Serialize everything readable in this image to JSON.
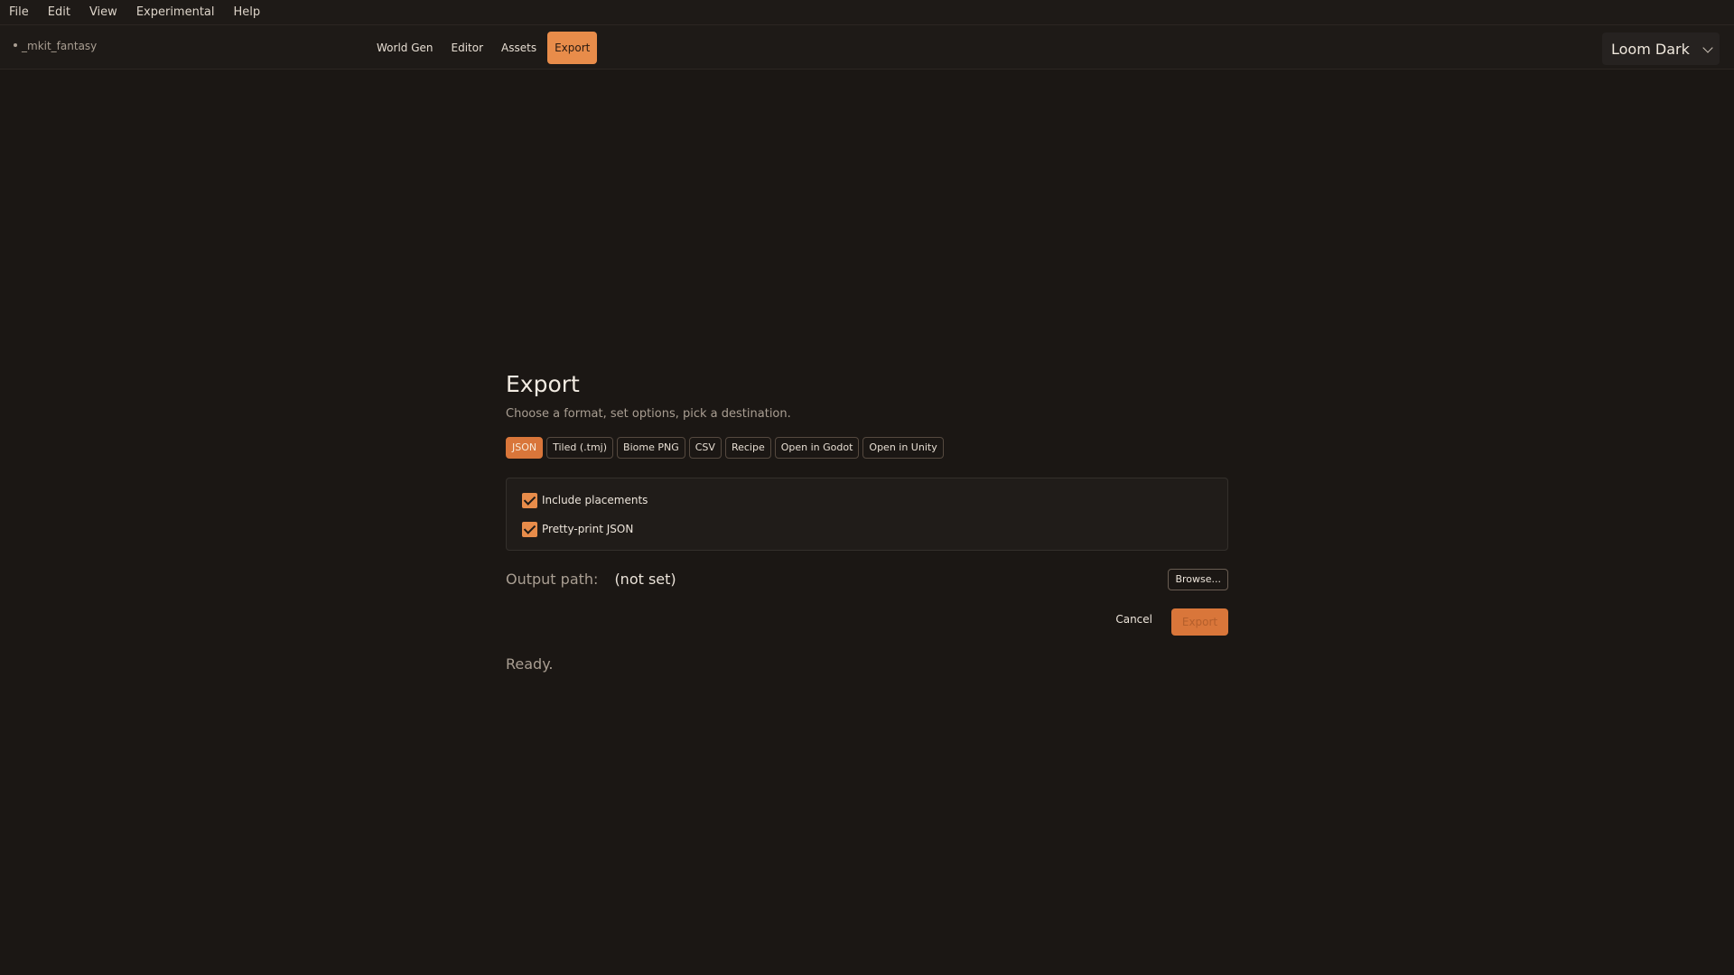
{
  "menubar": {
    "items": [
      "File",
      "Edit",
      "View",
      "Experimental",
      "Help"
    ]
  },
  "toolbar": {
    "project_name": "_mkit_fantasy",
    "tabs": [
      "World Gen",
      "Editor",
      "Assets",
      "Export"
    ],
    "active_tab": "Export",
    "theme": "Loom Dark"
  },
  "export_panel": {
    "title": "Export",
    "subtitle": "Choose a format, set options, pick a destination.",
    "formats": [
      "JSON",
      "Tiled (.tmj)",
      "Biome PNG",
      "CSV",
      "Recipe",
      "Open in Godot",
      "Open in Unity"
    ],
    "selected_format": "JSON",
    "options": [
      {
        "label": "Include placements",
        "checked": true
      },
      {
        "label": "Pretty-print JSON",
        "checked": true
      }
    ],
    "output_label": "Output path:",
    "output_value": "(not set)",
    "browse_label": "Browse...",
    "cancel_label": "Cancel",
    "export_label": "Export",
    "status": "Ready."
  },
  "colors": {
    "accent": "#e88c4a",
    "background": "#1b1714"
  }
}
